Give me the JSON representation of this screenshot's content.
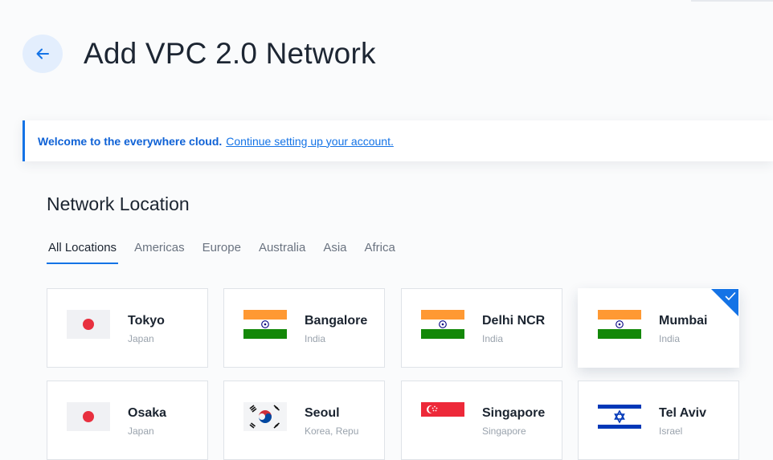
{
  "header": {
    "title": "Add VPC 2.0 Network"
  },
  "banner": {
    "strong": "Welcome to the everywhere cloud.",
    "link": "Continue setting up your account."
  },
  "section": {
    "title": "Network Location"
  },
  "tabs": [
    {
      "label": "All Locations",
      "active": true
    },
    {
      "label": "Americas"
    },
    {
      "label": "Europe"
    },
    {
      "label": "Australia"
    },
    {
      "label": "Asia"
    },
    {
      "label": "Africa"
    }
  ],
  "locations": [
    {
      "city": "Tokyo",
      "country": "Japan",
      "flag": "japan-flag-icon"
    },
    {
      "city": "Bangalore",
      "country": "India",
      "flag": "india-flag-icon"
    },
    {
      "city": "Delhi NCR",
      "country": "India",
      "flag": "india-flag-icon"
    },
    {
      "city": "Mumbai",
      "country": "India",
      "flag": "india-flag-icon",
      "selected": true
    },
    {
      "city": "Osaka",
      "country": "Japan",
      "flag": "japan-flag-icon"
    },
    {
      "city": "Seoul",
      "country": "Korea, Repu",
      "flag": "south-korea-flag-icon"
    },
    {
      "city": "Singapore",
      "country": "Singapore",
      "flag": "singapore-flag-icon"
    },
    {
      "city": "Tel Aviv",
      "country": "Israel",
      "flag": "israel-flag-icon"
    }
  ],
  "colors": {
    "accent": "#1473e6",
    "india_saffron": "#ff9933",
    "india_green": "#138808",
    "japan_red": "#e8303f"
  }
}
